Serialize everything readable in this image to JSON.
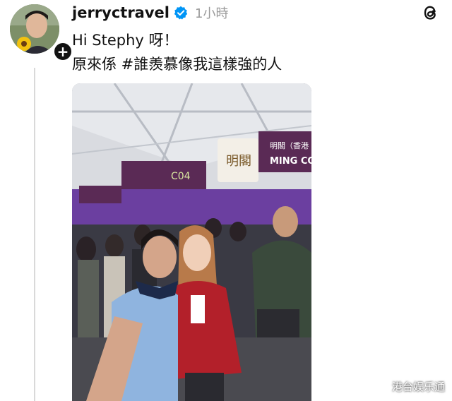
{
  "post": {
    "username": "jerryctravel",
    "timestamp": "1小時",
    "line1": "Hi Stephy 呀！",
    "line2": "原來係 #誰羨慕像我這樣強的人"
  },
  "photo": {
    "booth_sign_main": "明閣",
    "booth_sign_right_cn": "明閣（香港",
    "booth_sign_right_en": "MING CO",
    "booth_code": "C04"
  },
  "icons": {
    "verified": "verified-badge-icon",
    "follow": "plus-icon",
    "app_logo": "threads-logo-icon"
  },
  "colors": {
    "verified_blue": "#0095f6",
    "sign_purple": "#5a2a55",
    "tent_purple": "#6b3fa0",
    "jacket_red": "#b3202a"
  },
  "watermark": "港台娱乐通"
}
